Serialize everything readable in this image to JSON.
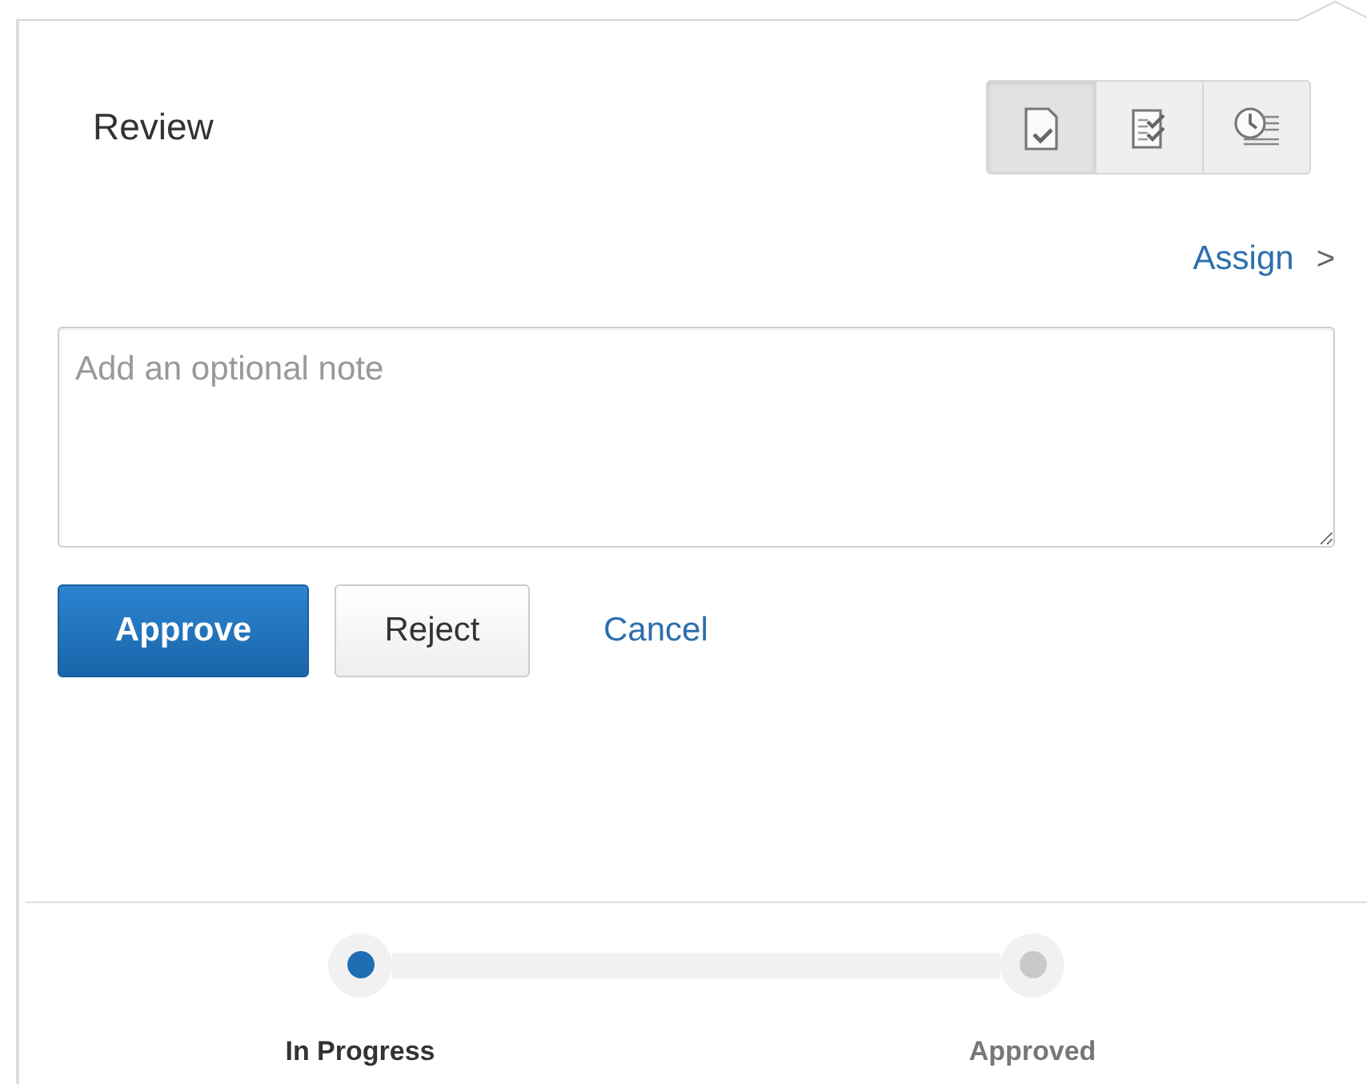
{
  "title": "Review",
  "view_buttons": [
    {
      "kind": "document-check",
      "selected": true
    },
    {
      "kind": "checklist",
      "selected": false
    },
    {
      "kind": "clock-list",
      "selected": false
    }
  ],
  "assign_link": {
    "label": "Assign",
    "arrow": ">"
  },
  "note": {
    "placeholder": "Add an optional note"
  },
  "actions": [
    {
      "label": "Approve",
      "kind": "primary"
    },
    {
      "label": "Reject",
      "kind": "default"
    },
    {
      "label": "Cancel",
      "kind": "link"
    }
  ],
  "steps": [
    {
      "label": "In Progress",
      "selected": true
    },
    {
      "label": "Approved",
      "selected": false
    }
  ]
}
